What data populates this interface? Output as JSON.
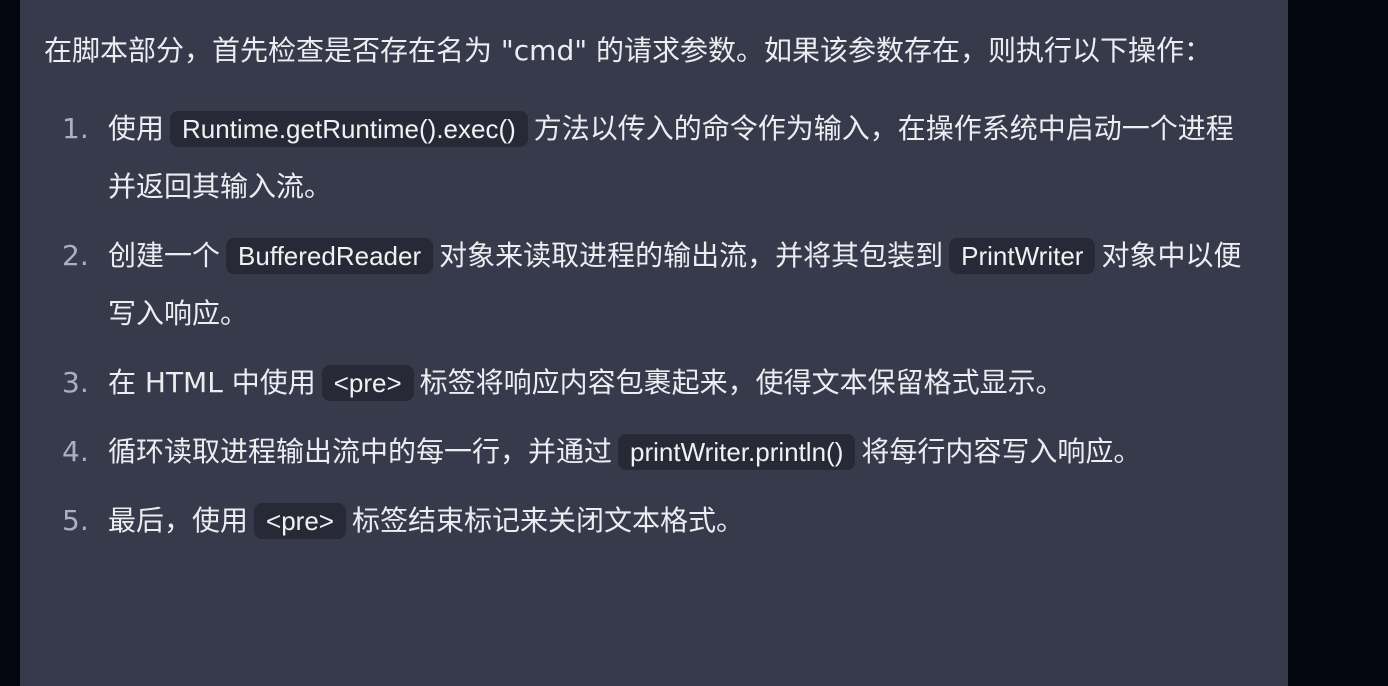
{
  "intro": "在脚本部分，首先检查是否存在名为 \"cmd\" 的请求参数。如果该参数存在，则执行以下操作：",
  "steps": [
    {
      "num": "1.",
      "before": "使用",
      "code": "Runtime.getRuntime().exec()",
      "after": "方法以传入的命令作为输入，在操作系统中启动一个进程并返回其输入流。"
    },
    {
      "num": "2.",
      "before": "创建一个",
      "code": "BufferedReader",
      "middle": "对象来读取进程的输出流，并将其包装到",
      "code2": "PrintWriter",
      "after": "对象中以便写入响应。"
    },
    {
      "num": "3.",
      "before": "在 HTML 中使用",
      "code": "<pre>",
      "after": "标签将响应内容包裹起来，使得文本保留格式显示。"
    },
    {
      "num": "4.",
      "before": "循环读取进程输出流中的每一行，并通过",
      "code": "printWriter.println()",
      "after": "将每行内容写入响应。"
    },
    {
      "num": "5.",
      "before": "最后，使用",
      "code": "<pre>",
      "after": "标签结束标记来关闭文本格式。"
    }
  ]
}
